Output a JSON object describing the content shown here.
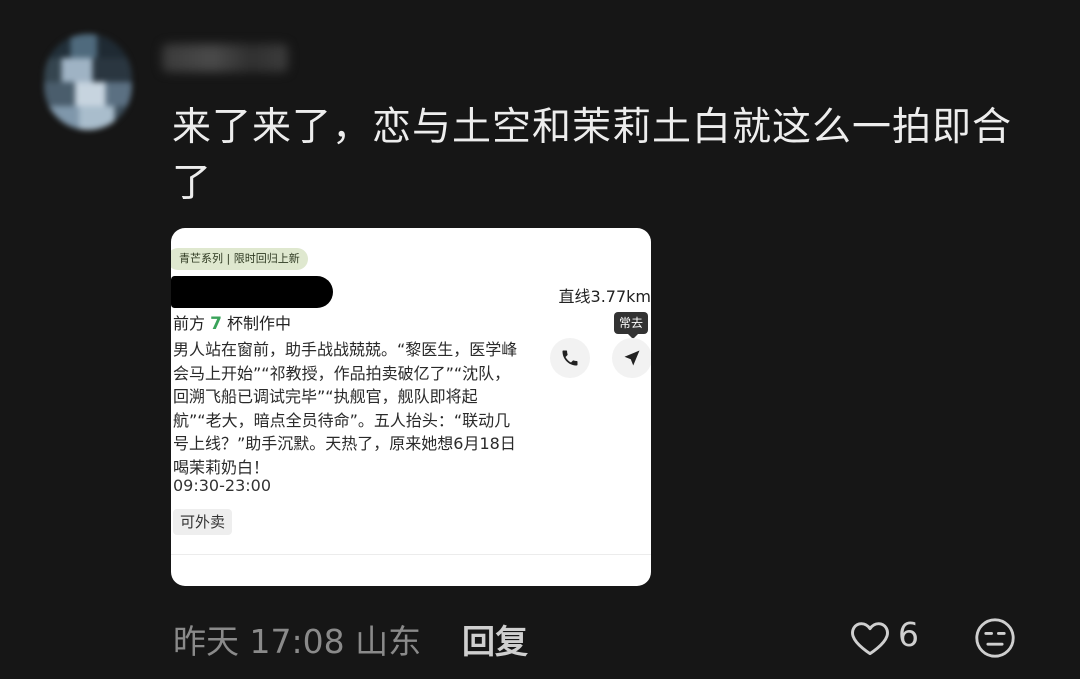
{
  "comment": {
    "text": "来了来了，恋与土空和茉莉土白就这么一拍即合了"
  },
  "card": {
    "tag": "青芒系列 | 限时回归上新",
    "distance": "直线3.77km",
    "queue_prefix": "前方",
    "queue_number": "7",
    "queue_suffix": "杯制作中",
    "description": "男人站在窗前，助手战战兢兢。“黎医生，医学峰会马上开始”“祁教授，作品拍卖破亿了”“沈队，回溯飞船已调试完毕”“执舰官，舰队即将起航”“老大，暗点全员待命”。五人抬头：“联动几号上线？”助手沉默。天热了，原来她想6月18日喝茉莉奶白！",
    "hours": "09:30-23:00",
    "takeout": "可外卖",
    "tooltip": "常去",
    "phone_icon": "phone-icon",
    "nav_icon": "navigation-arrow-icon"
  },
  "footer": {
    "meta": "昨天 17:08 山东",
    "reply": "回复",
    "like_count": "6",
    "like_icon": "heart-outline-icon",
    "emoji_icon": "emoji-face-icon"
  },
  "colors": {
    "background": "#161616",
    "queue_accent": "#3aa35a",
    "tag_bg": "#dfe8cf"
  }
}
